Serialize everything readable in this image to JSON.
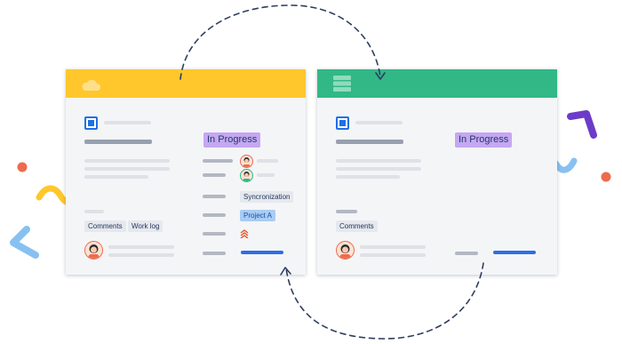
{
  "left_card": {
    "header_color": "#FFC72C",
    "header_icon": "cloud-icon",
    "status": "In Progress",
    "tags": [
      "Comments",
      "Work log"
    ],
    "fields": {
      "sync_label": "Syncronization",
      "project_label": "Project A",
      "priority_icon": "priority-highest-icon"
    }
  },
  "right_card": {
    "header_color": "#31B886",
    "header_icon": "server-icon",
    "status": "In Progress",
    "tags": [
      "Comments"
    ]
  },
  "colors": {
    "status_bg": "#C5A7F2",
    "accent_blue": "#2B6EE8",
    "connector": "#2F3D5F"
  }
}
